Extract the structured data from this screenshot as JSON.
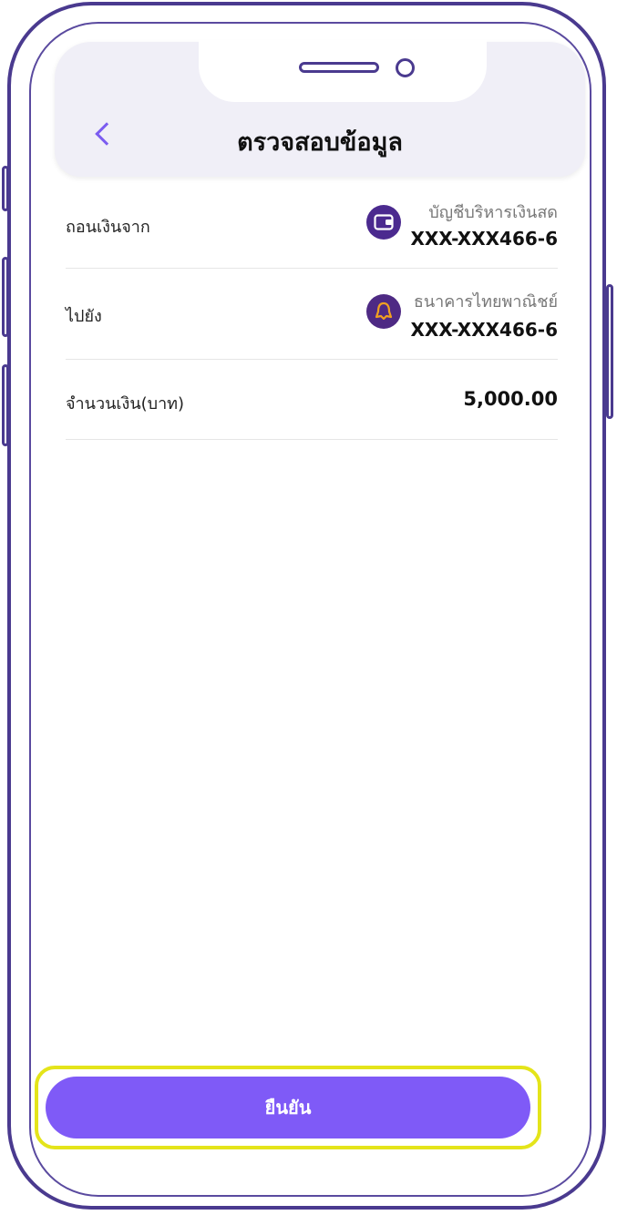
{
  "header": {
    "title": "ตรวจสอบข้อมูล"
  },
  "from": {
    "label": "ถอนเงินจาก",
    "account_name": "บัญชีบริหารเงินสด",
    "account_number": "XXX-XXX466-6",
    "icon": "wallet-icon",
    "icon_color": "#4b2a8f"
  },
  "to": {
    "label": "ไปยัง",
    "bank_name": "ธนาคารไทยพาณิชย์",
    "account_number": "XXX-XXX466-6",
    "icon": "scb-bank-icon",
    "icon_color": "#4e2a84",
    "icon_accent": "#f0a020"
  },
  "amount": {
    "label": "จำนวนเงิน(บาท)",
    "value": "5,000.00"
  },
  "confirm": {
    "label": "ยืนยัน"
  },
  "colors": {
    "primary": "#7f5af7",
    "frame": "#4a3a8f",
    "highlight": "#e4e41a"
  }
}
